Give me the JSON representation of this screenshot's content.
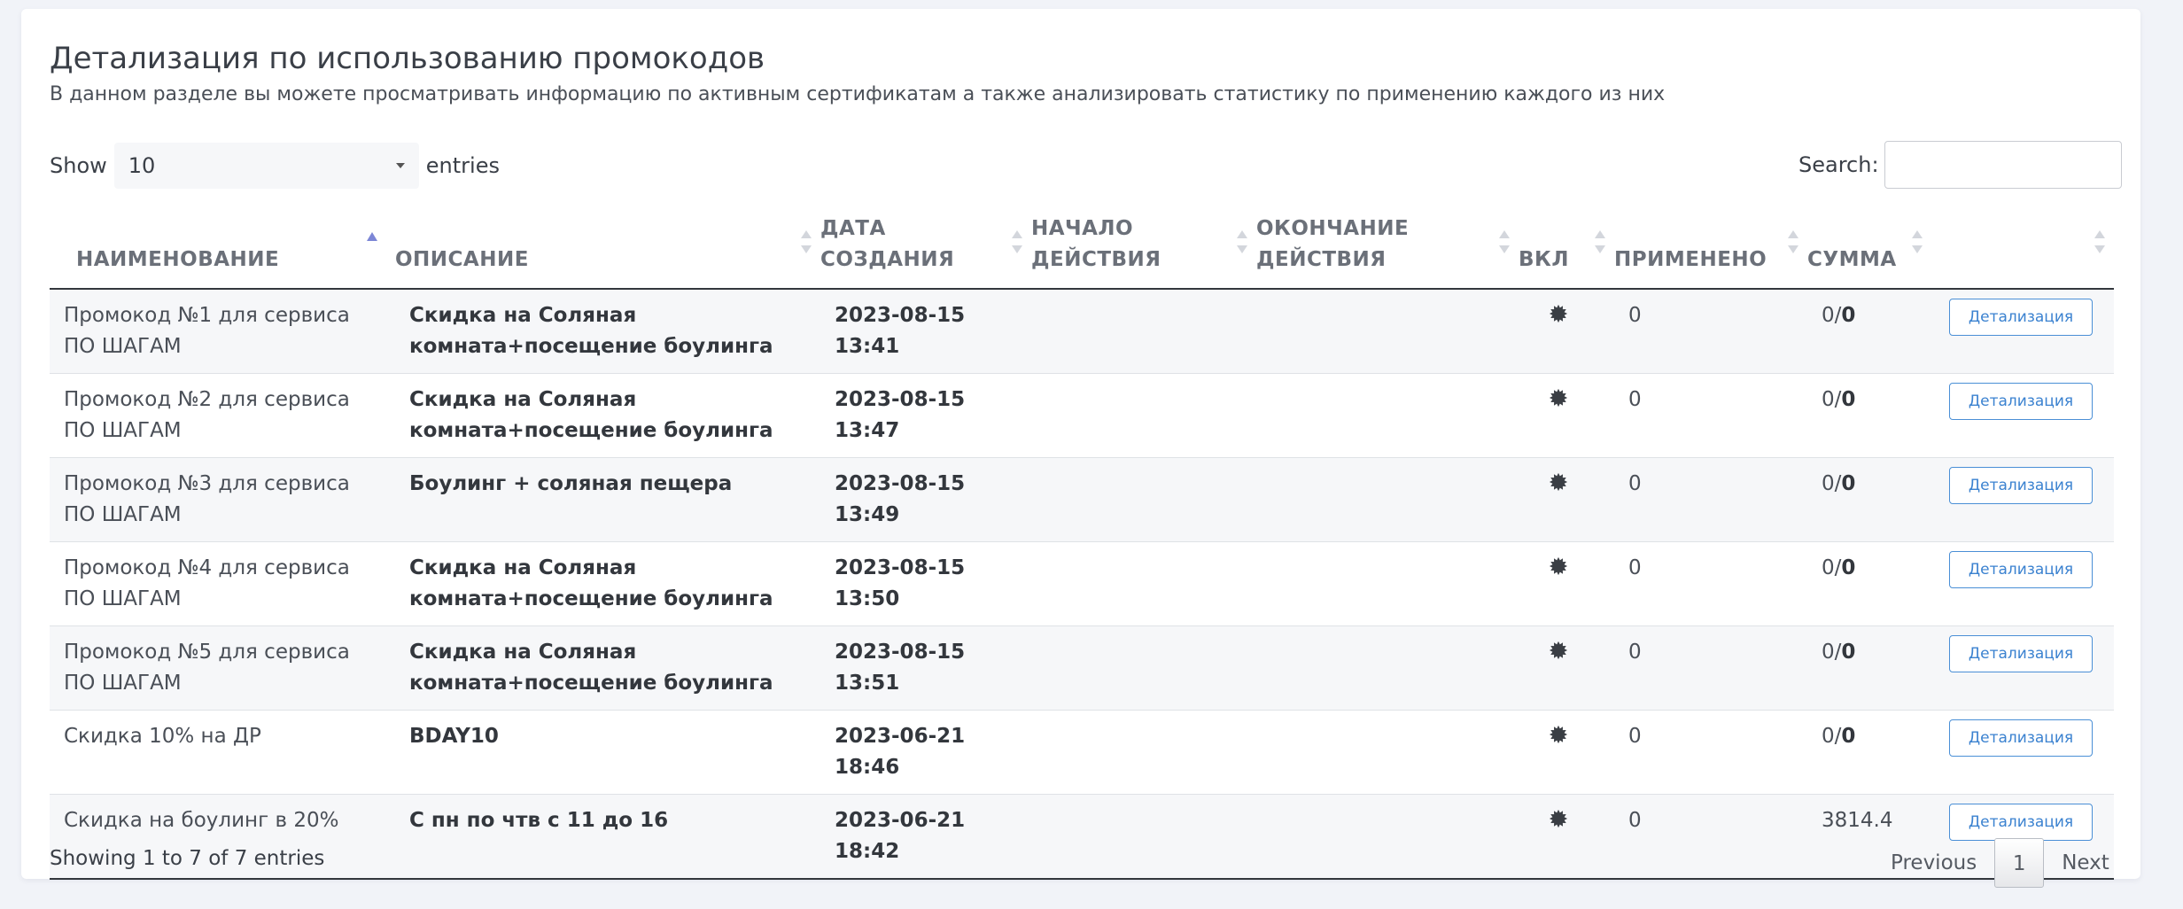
{
  "header": {
    "title": "Детализация по использованию промокодов",
    "subtitle": "В данном разделе вы можете просматривать информацию по активным сертификатам а также анализировать статистику по применению каждого из них"
  },
  "length": {
    "prefix": "Show",
    "value": "10",
    "suffix": "entries"
  },
  "search": {
    "label": "Search:",
    "value": ""
  },
  "table": {
    "columns": [
      {
        "label": "НАИМЕНОВАНИЕ",
        "sort": "asc"
      },
      {
        "label": "ОПИСАНИЕ",
        "sort": "both"
      },
      {
        "label": "ДАТА СОЗДАНИЯ",
        "sort": "both"
      },
      {
        "label": "НАЧАЛО ДЕЙСТВИЯ",
        "sort": "both"
      },
      {
        "label": "ОКОНЧАНИЕ ДЕЙСТВИЯ",
        "sort": "both"
      },
      {
        "label": "ВКЛ",
        "sort": "both"
      },
      {
        "label": "ПРИМЕНЕНО",
        "sort": "both"
      },
      {
        "label": "СУММА",
        "sort": "both"
      },
      {
        "label": "",
        "sort": "both"
      }
    ],
    "rows": [
      {
        "name": "Промокод №1 для сервиса ПО ШАГАМ",
        "description": "Скидка на Соляная комната+посещение боулинга",
        "created": "2023-08-15 13:41",
        "start": "",
        "end": "",
        "enabled_icon": "gear-icon",
        "applied": "0",
        "sum_a": "0/",
        "sum_b": "0",
        "action": "Детализация"
      },
      {
        "name": "Промокод №2 для сервиса ПО ШАГАМ",
        "description": "Скидка на Соляная комната+посещение боулинга",
        "created": "2023-08-15 13:47",
        "start": "",
        "end": "",
        "enabled_icon": "gear-icon",
        "applied": "0",
        "sum_a": "0/",
        "sum_b": "0",
        "action": "Детализация"
      },
      {
        "name": "Промокод №3 для сервиса ПО ШАГАМ",
        "description": "Боулинг + соляная пещера",
        "created": "2023-08-15 13:49",
        "start": "",
        "end": "",
        "enabled_icon": "gear-icon",
        "applied": "0",
        "sum_a": "0/",
        "sum_b": "0",
        "action": "Детализация"
      },
      {
        "name": "Промокод №4 для сервиса ПО ШАГАМ",
        "description": "Скидка на Соляная комната+посещение боулинга",
        "created": "2023-08-15 13:50",
        "start": "",
        "end": "",
        "enabled_icon": "gear-icon",
        "applied": "0",
        "sum_a": "0/",
        "sum_b": "0",
        "action": "Детализация"
      },
      {
        "name": "Промокод №5 для сервиса ПО ШАГАМ",
        "description": "Скидка на Соляная комната+посещение боулинга",
        "created": "2023-08-15 13:51",
        "start": "",
        "end": "",
        "enabled_icon": "gear-icon",
        "applied": "0",
        "sum_a": "0/",
        "sum_b": "0",
        "action": "Детализация"
      },
      {
        "name": "Скидка 10% на ДР",
        "description": "BDAY10",
        "created": "2023-06-21 18:46",
        "start": "",
        "end": "",
        "enabled_icon": "gear-icon",
        "applied": "0",
        "sum_a": "0/",
        "sum_b": "0",
        "action": "Детализация"
      },
      {
        "name": "Скидка на боулинг в 20%",
        "description": "С пн по чтв с 11 до 16",
        "created": "2023-06-21 18:42",
        "start": "",
        "end": "",
        "enabled_icon": "gear-icon",
        "applied": "0",
        "sum_a": "3814.4",
        "sum_b": "",
        "action": "Детализация"
      }
    ]
  },
  "footer": {
    "info": "Showing 1 to 7 of 7 entries",
    "previous": "Previous",
    "current_page": "1",
    "next": "Next"
  },
  "colors": {
    "accent": "#3b82d0",
    "sort_active": "#7c86d6",
    "background": "#f1f3f8"
  }
}
